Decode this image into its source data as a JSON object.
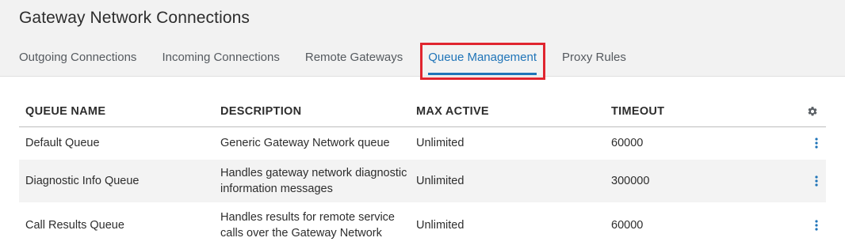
{
  "page": {
    "title": "Gateway Network Connections"
  },
  "tabs": [
    {
      "label": "Outgoing Connections",
      "active": false
    },
    {
      "label": "Incoming Connections",
      "active": false
    },
    {
      "label": "Remote Gateways",
      "active": false
    },
    {
      "label": "Queue Management",
      "active": true
    },
    {
      "label": "Proxy Rules",
      "active": false
    }
  ],
  "table": {
    "headers": {
      "name": "QUEUE NAME",
      "description": "DESCRIPTION",
      "max_active": "MAX ACTIVE",
      "timeout": "TIMEOUT"
    },
    "settings_icon": "gear-icon",
    "row_menu_icon": "kebab-menu-icon",
    "rows": [
      {
        "name": "Default Queue",
        "description": "Generic Gateway Network queue",
        "max_active": "Unlimited",
        "timeout": "60000"
      },
      {
        "name": "Diagnostic Info Queue",
        "description": "Handles gateway network diagnostic information messages",
        "max_active": "Unlimited",
        "timeout": "300000"
      },
      {
        "name": "Call Results Queue",
        "description": "Handles results for remote service calls over the Gateway Network",
        "max_active": "Unlimited",
        "timeout": "60000"
      }
    ]
  },
  "colors": {
    "accent": "#1f74b8",
    "highlight": "#e0252f",
    "header_bg": "#f2f2f2",
    "alt_row_bg": "#f3f3f3"
  }
}
